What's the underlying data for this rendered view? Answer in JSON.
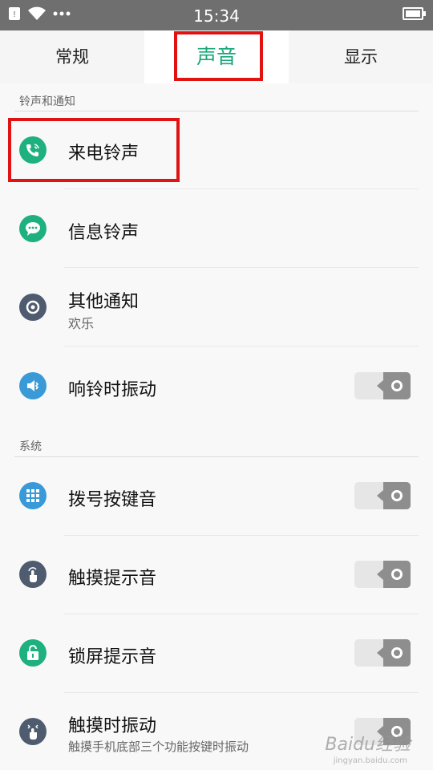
{
  "status_bar": {
    "time": "15:34",
    "icons": [
      "sim-icon",
      "wifi-icon",
      "more-dots-icon",
      "battery-icon"
    ]
  },
  "tabs": [
    {
      "label": "常规",
      "active": false
    },
    {
      "label": "声音",
      "active": true
    },
    {
      "label": "显示",
      "active": false
    }
  ],
  "sections": {
    "ringtones": {
      "title": "铃声和通知",
      "items": [
        {
          "label": "来电铃声",
          "icon": "phone-icon"
        },
        {
          "label": "信息铃声",
          "icon": "chat-bubble-icon"
        },
        {
          "label": "其他通知",
          "sub": "欢乐",
          "icon": "speaker-icon"
        },
        {
          "label": "响铃时振动",
          "icon": "vibrate-speaker-icon",
          "toggle": false
        }
      ]
    },
    "system": {
      "title": "系统",
      "items": [
        {
          "label": "拨号按键音",
          "icon": "dialpad-icon",
          "toggle": false
        },
        {
          "label": "触摸提示音",
          "icon": "touch-hand-icon",
          "toggle": false
        },
        {
          "label": "锁屏提示音",
          "icon": "lock-icon",
          "toggle": false
        },
        {
          "label": "触摸时振动",
          "sub": "触摸手机底部三个功能按键时振动",
          "icon": "touch-vibrate-icon",
          "toggle": false
        }
      ]
    }
  },
  "colors": {
    "accent": "#1aa779",
    "highlight": "#e01212",
    "status_bar": "#6f6f6f"
  },
  "watermark": {
    "brand": "Baidu经验",
    "url": "jingyan.baidu.com"
  }
}
